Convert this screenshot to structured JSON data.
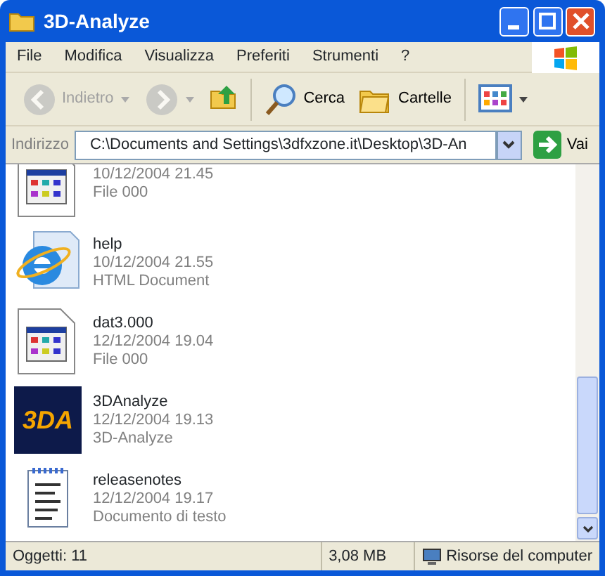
{
  "window": {
    "title": "3D-Analyze"
  },
  "menu": [
    "File",
    "Modifica",
    "Visualizza",
    "Preferiti",
    "Strumenti",
    "?"
  ],
  "toolbar": [
    {
      "kind": "back",
      "label": "Indietro",
      "disabled": true
    },
    {
      "kind": "forward",
      "disabled": true
    },
    {
      "kind": "up",
      "disabled": false
    },
    {
      "kind": "search",
      "label": "Cerca",
      "disabled": false
    },
    {
      "kind": "folders",
      "label": "Cartelle",
      "disabled": false
    },
    {
      "kind": "views",
      "disabled": false
    }
  ],
  "address": {
    "label": "Indirizzo",
    "value": "C:\\Documents and Settings\\3dfxzone.it\\Desktop\\3D-An",
    "go": "Vai"
  },
  "files": [
    {
      "kind": "dat",
      "date": "10/12/2004 21.45",
      "type": "File 000"
    },
    {
      "kind": "html",
      "name": "help",
      "date": "10/12/2004 21.55",
      "type": "HTML Document"
    },
    {
      "kind": "dat",
      "name": "dat3.000",
      "date": "12/12/2004 19.04",
      "type": "File 000"
    },
    {
      "kind": "app",
      "logo": "3DA",
      "name": "3DAnalyze",
      "date": "12/12/2004 19.13",
      "type": "3D-Analyze"
    },
    {
      "kind": "text",
      "name": "releasenotes",
      "date": "12/12/2004 19.17",
      "type": "Documento di testo"
    }
  ],
  "status_bar": {
    "objects": "Oggetti: 11",
    "size": "3,08 MB",
    "location": "Risorse del computer"
  }
}
